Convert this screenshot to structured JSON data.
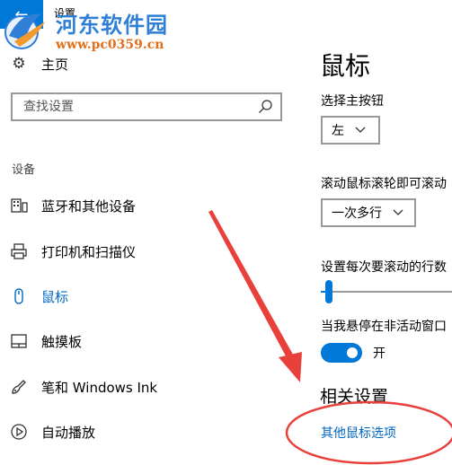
{
  "window": {
    "title": "设置",
    "back_icon": "back-arrow-icon"
  },
  "watermark": {
    "title": "河东软件园",
    "url": "www.pc0359.cn"
  },
  "sidebar": {
    "home": {
      "label": "主页",
      "icon": "gear-icon"
    },
    "search": {
      "placeholder": "查找设置",
      "icon": "search-icon"
    },
    "section_header": "设备",
    "items": [
      {
        "label": "蓝牙和其他设备",
        "icon": "bluetooth-devices-icon",
        "active": false
      },
      {
        "label": "打印机和扫描仪",
        "icon": "printer-icon",
        "active": false
      },
      {
        "label": "鼠标",
        "icon": "mouse-icon",
        "active": true
      },
      {
        "label": "触摸板",
        "icon": "touchpad-icon",
        "active": false
      },
      {
        "label": "笔和 Windows Ink",
        "icon": "pen-icon",
        "active": false
      },
      {
        "label": "自动播放",
        "icon": "autoplay-icon",
        "active": false
      }
    ]
  },
  "main": {
    "title": "鼠标",
    "primary_button": {
      "label": "选择主按钮",
      "value": "左"
    },
    "scroll_mode": {
      "label": "滚动鼠标滚轮即可滚动",
      "value": "一次多行"
    },
    "lines_to_scroll": {
      "label": "设置每次要滚动的行数",
      "level_percent": 6
    },
    "inactive_scroll": {
      "label": "当我悬停在非活动窗口",
      "toggle_on": true,
      "state_label": "开"
    },
    "related": {
      "title": "相关设置",
      "link": "其他鼠标选项"
    }
  },
  "colors": {
    "accent": "#0078d7",
    "link": "#0067c0",
    "annotation": "#e8403a",
    "watermark_blue": "#2f7fd6",
    "watermark_orange": "#e0701c"
  }
}
